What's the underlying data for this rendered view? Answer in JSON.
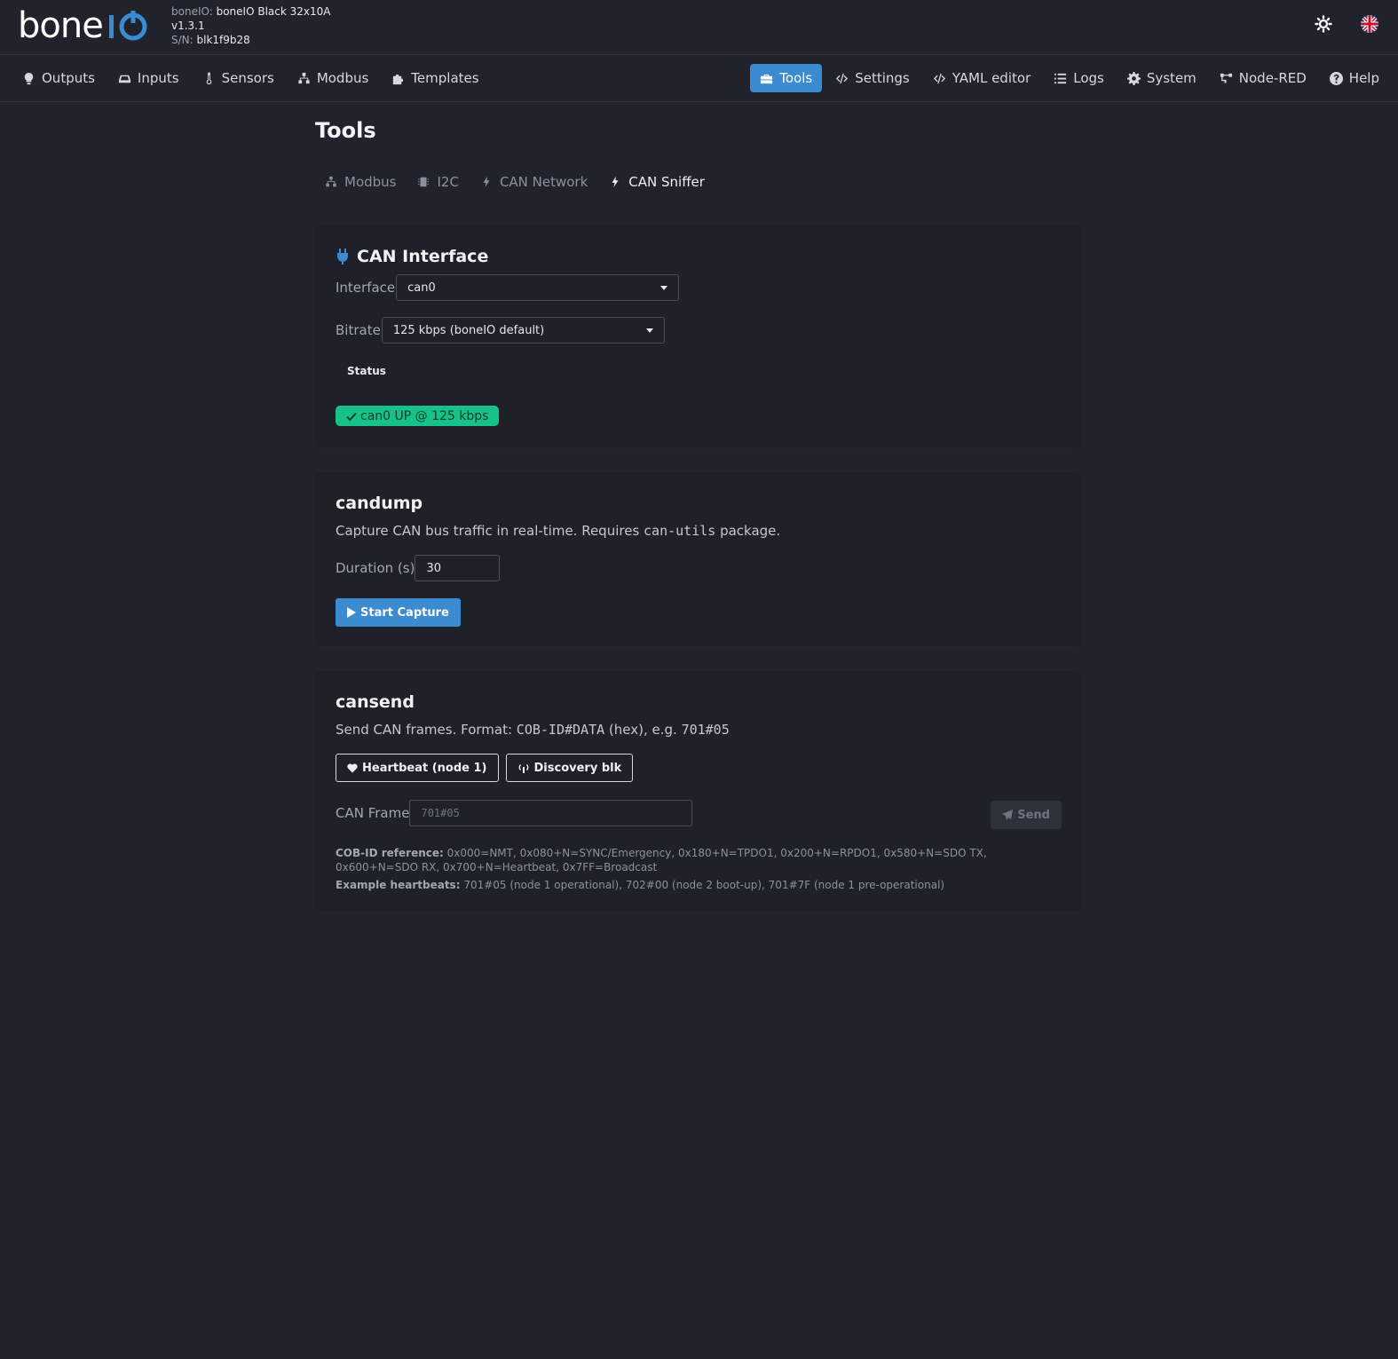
{
  "brand": {
    "logo_text": "boneIO"
  },
  "device": {
    "name_label": "boneIO:",
    "name_value": "boneIO Black 32x10A",
    "version": "v1.3.1",
    "serial_label": "S/N:",
    "serial_value": "blk1f9b28"
  },
  "top_icons": [
    "theme-toggle-icon",
    "language-flag-icon"
  ],
  "nav": {
    "left": [
      {
        "label": "Outputs",
        "icon": "lightbulb-icon"
      },
      {
        "label": "Inputs",
        "icon": "input-icon"
      },
      {
        "label": "Sensors",
        "icon": "thermometer-icon"
      },
      {
        "label": "Modbus",
        "icon": "network-icon"
      },
      {
        "label": "Templates",
        "icon": "puzzle-icon"
      }
    ],
    "right": [
      {
        "label": "Tools",
        "icon": "toolbox-icon",
        "active": true
      },
      {
        "label": "Settings",
        "icon": "code-icon"
      },
      {
        "label": "YAML editor",
        "icon": "code-icon"
      },
      {
        "label": "Logs",
        "icon": "list-icon"
      },
      {
        "label": "System",
        "icon": "gear-icon"
      },
      {
        "label": "Node-RED",
        "icon": "flow-icon"
      },
      {
        "label": "Help",
        "icon": "question-icon"
      }
    ]
  },
  "page": {
    "title": "Tools",
    "tabs": [
      {
        "label": "Modbus",
        "icon": "network-icon"
      },
      {
        "label": "I2C",
        "icon": "chip-icon"
      },
      {
        "label": "CAN Network",
        "icon": "bolt-icon"
      },
      {
        "label": "CAN Sniffer",
        "icon": "bolt-icon",
        "active": true
      }
    ]
  },
  "can_interface": {
    "title": "CAN Interface",
    "interface_label": "Interface",
    "interface_value": "can0",
    "bitrate_label": "Bitrate",
    "bitrate_value": "125 kbps (boneIO default)",
    "status_label": "Status",
    "status_value": "can0 UP @ 125 kbps",
    "status_color": "#17c28a"
  },
  "candump": {
    "title": "candump",
    "desc_before": "Capture CAN bus traffic in real-time. Requires ",
    "desc_code": "can-utils",
    "desc_after": " package.",
    "duration_label": "Duration (s)",
    "duration_value": "30",
    "start_label": "Start Capture"
  },
  "cansend": {
    "title": "cansend",
    "desc_before": "Send CAN frames. Format: ",
    "desc_code1": "COB-ID#DATA",
    "desc_mid": " (hex), e.g. ",
    "desc_code2": "701#05",
    "heartbeat_label": "Heartbeat (node 1)",
    "discovery_label": "Discovery blk",
    "frame_label": "CAN Frame",
    "frame_placeholder": "701#05",
    "send_label": "Send",
    "ref_label": "COB-ID reference:",
    "ref_text": " 0x000=NMT, 0x080+N=SYNC/Emergency, 0x180+N=TPDO1, 0x200+N=RPDO1, 0x580+N=SDO TX, 0x600+N=SDO RX, 0x700+N=Heartbeat, 0x7FF=Broadcast",
    "example_label": "Example heartbeats:",
    "example_text": " 701#05 (node 1 operational), 702#00 (node 2 boot-up), 701#7F (node 1 pre-operational)"
  },
  "colors": {
    "accent": "#3b8bd1",
    "background": "#20232b",
    "success": "#17c28a"
  }
}
